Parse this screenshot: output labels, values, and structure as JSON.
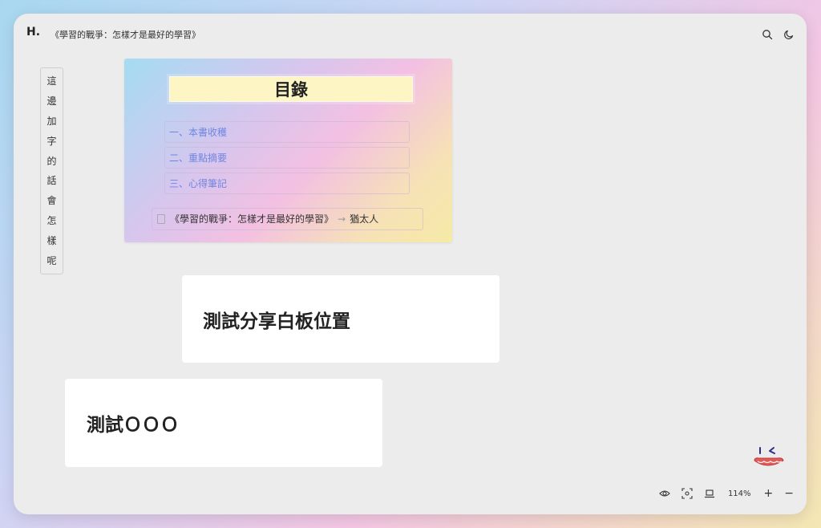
{
  "header": {
    "logo": "H.",
    "title": "《學習的戰爭：怎樣才是最好的學習》"
  },
  "icons": {
    "search": "search-icon",
    "theme": "moon-icon",
    "visibility": "eye-icon",
    "focus": "focus-icon",
    "present": "laptop-icon"
  },
  "vertical_note": {
    "chars": [
      "這",
      "邊",
      "加",
      "字",
      "的",
      "話",
      "會",
      "怎",
      "樣",
      "呢"
    ]
  },
  "toc": {
    "title": "目錄",
    "items": [
      "一、本書收穫",
      "二、重點摘要",
      "三、心得筆記"
    ],
    "reference": {
      "book": "《學習的戰爭：怎樣才是最好的學習》",
      "author": "猶太人"
    }
  },
  "cards": {
    "share": "測試分享白板位置",
    "test": "測試ＯＯＯ"
  },
  "toolbar": {
    "zoom": "114%",
    "zoom_in": "+",
    "zoom_out": "−"
  },
  "colors": {
    "link": "#6f86e0",
    "background": "#ececec",
    "title_highlight": "#fdf6c4"
  }
}
